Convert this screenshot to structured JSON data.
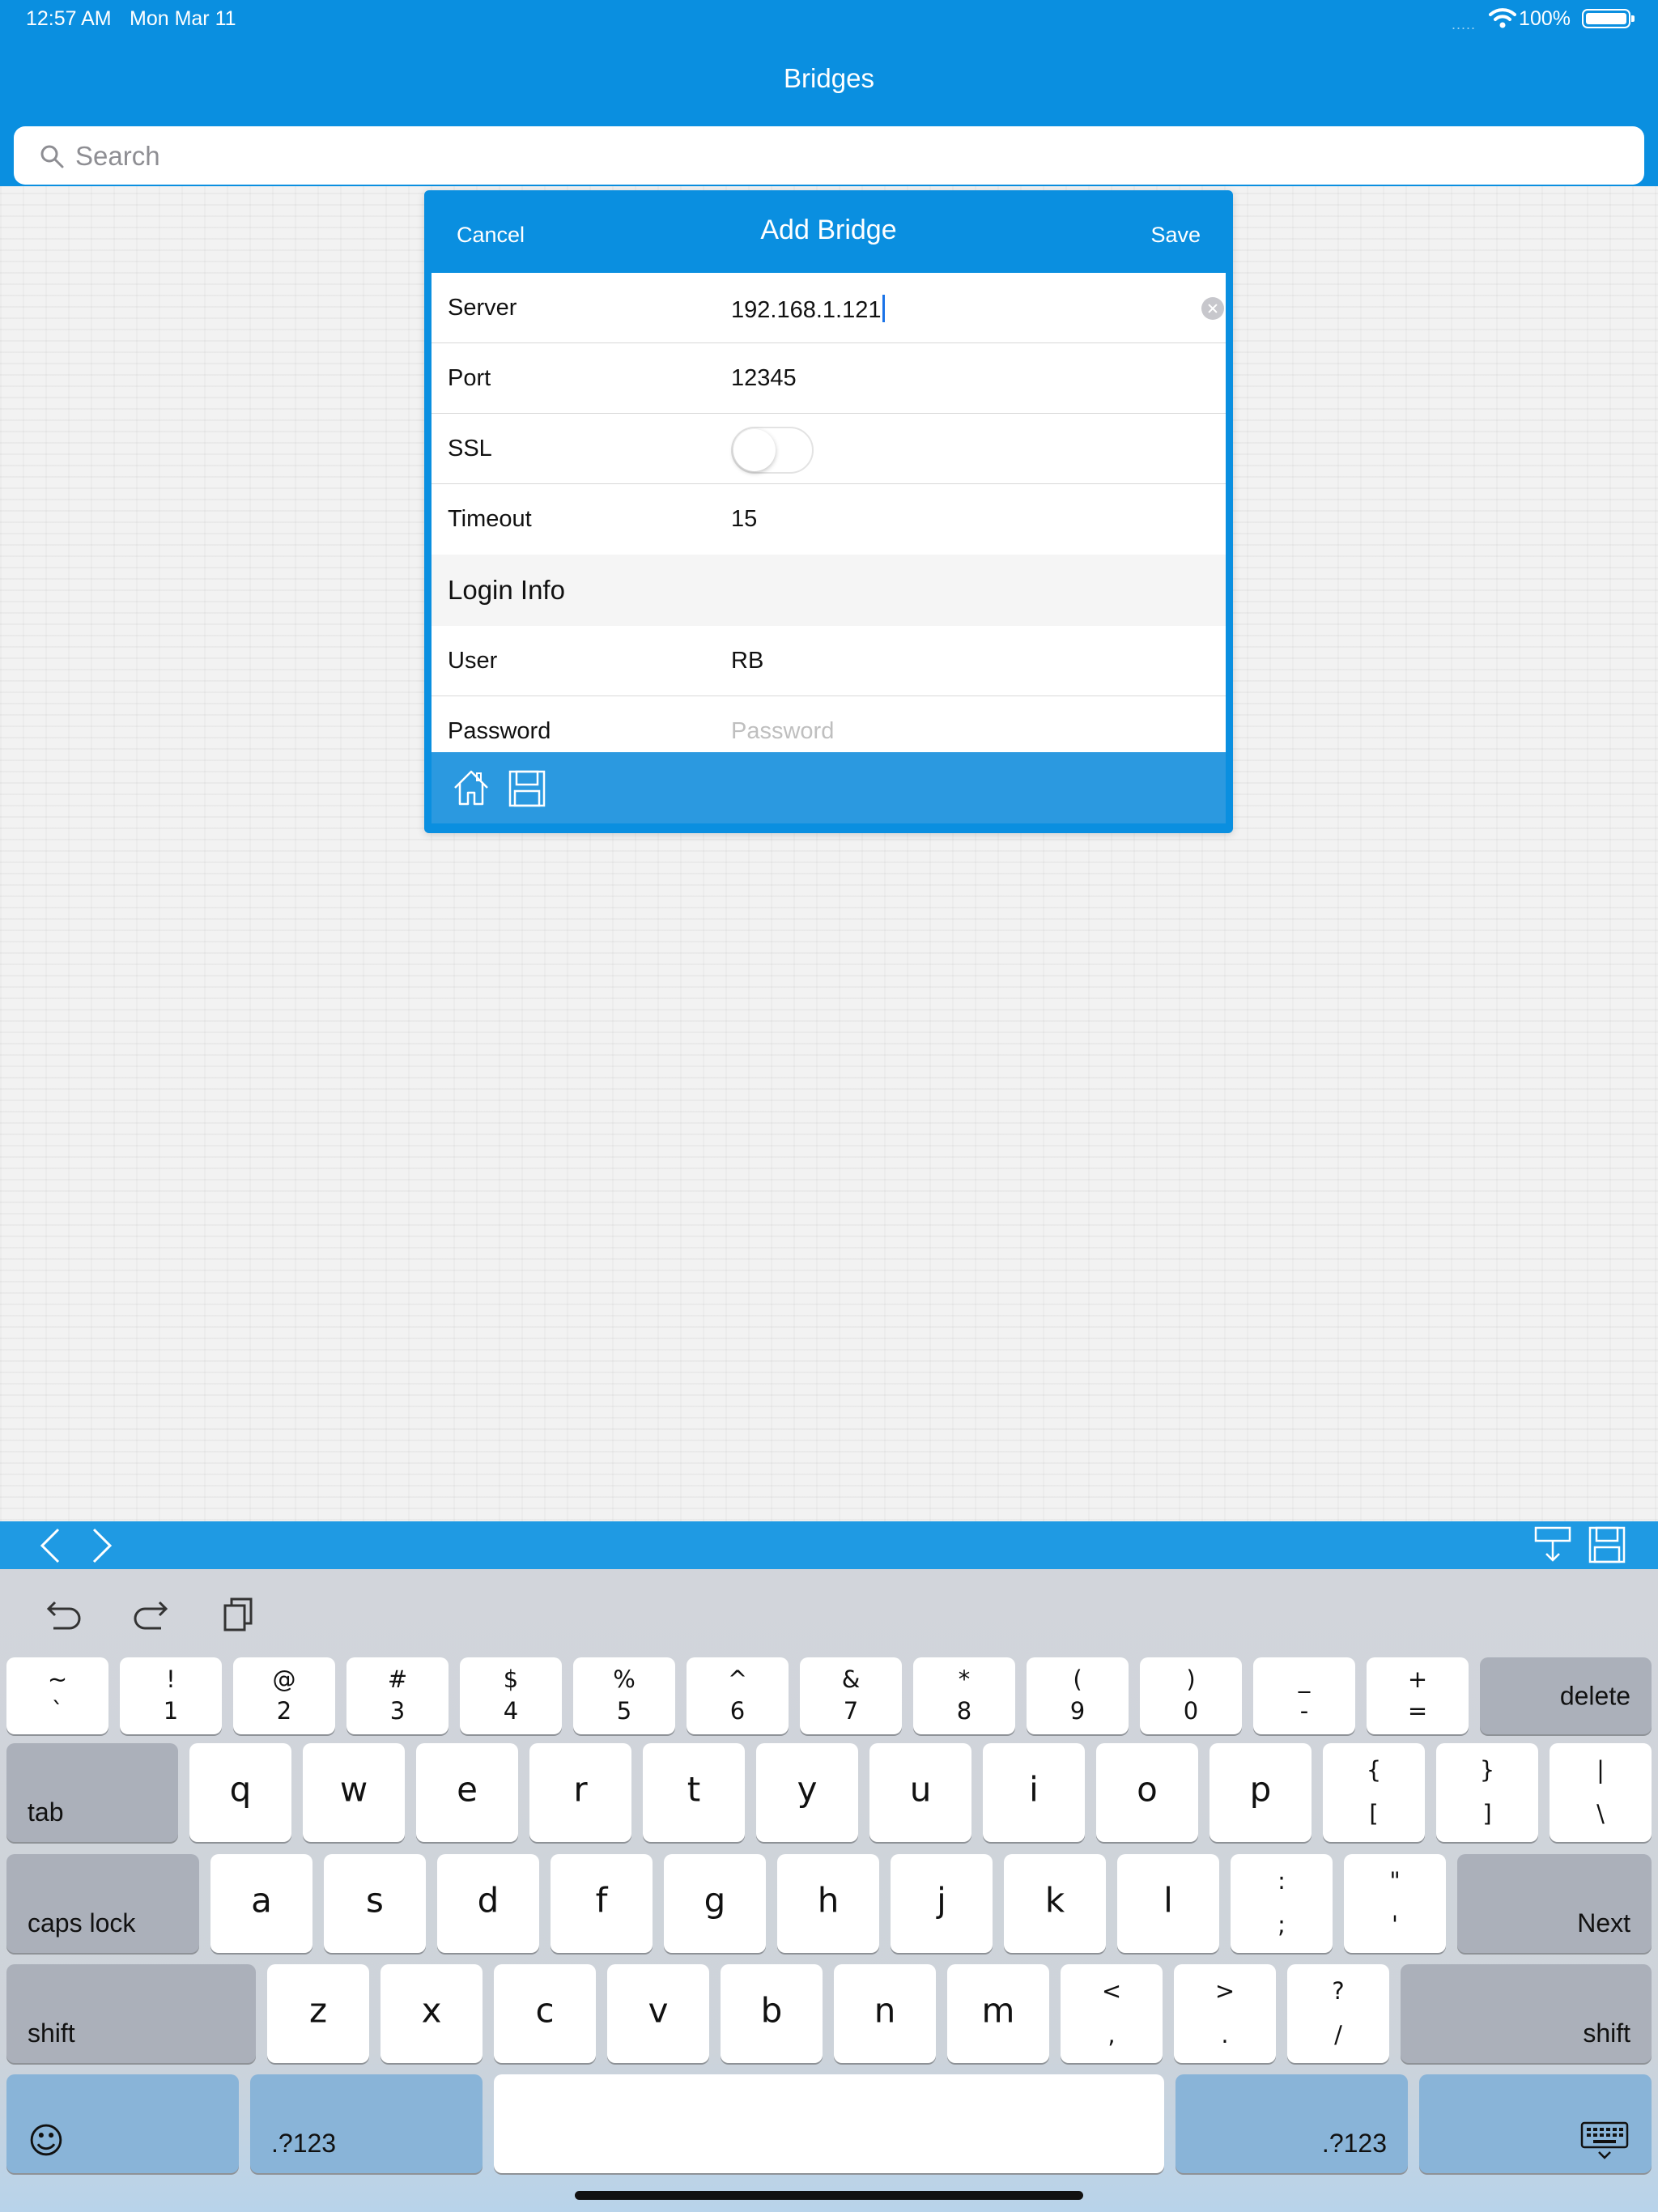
{
  "status_bar": {
    "time": "12:57 AM",
    "date": "Mon Mar 11",
    "battery": "100%",
    "signal_dots": "....."
  },
  "nav": {
    "title": "Bridges"
  },
  "search": {
    "placeholder": "Search",
    "value": ""
  },
  "modal": {
    "title": "Add Bridge",
    "cancel_label": "Cancel",
    "save_label": "Save",
    "fields": {
      "server": {
        "label": "Server",
        "value": "192.168.1.121"
      },
      "port": {
        "label": "Port",
        "value": "12345"
      },
      "ssl": {
        "label": "SSL",
        "enabled": false
      },
      "timeout": {
        "label": "Timeout",
        "value": "15"
      },
      "login_section": "Login Info",
      "user": {
        "label": "User",
        "value": "RB"
      },
      "password": {
        "label": "Password",
        "placeholder": "Password",
        "value": ""
      }
    },
    "toolbar_icons": [
      "home-icon",
      "floppy-disk-icon"
    ]
  },
  "accessory_bar": {
    "icons": [
      "chevron-left-icon",
      "chevron-right-icon",
      "dismiss-keyboard-icon",
      "floppy-disk-icon"
    ]
  },
  "keyboard": {
    "shortcut_icons": [
      "undo-icon",
      "redo-icon",
      "paste-icon"
    ],
    "number_row": [
      {
        "top": "~",
        "bottom": "`"
      },
      {
        "top": "!",
        "bottom": "1"
      },
      {
        "top": "@",
        "bottom": "2"
      },
      {
        "top": "#",
        "bottom": "3"
      },
      {
        "top": "$",
        "bottom": "4"
      },
      {
        "top": "%",
        "bottom": "5"
      },
      {
        "top": "^",
        "bottom": "6"
      },
      {
        "top": "&",
        "bottom": "7"
      },
      {
        "top": "*",
        "bottom": "8"
      },
      {
        "top": "(",
        "bottom": "9"
      },
      {
        "top": ")",
        "bottom": "0"
      },
      {
        "top": "_",
        "bottom": "-"
      },
      {
        "top": "+",
        "bottom": "="
      }
    ],
    "delete": "delete",
    "tab": "tab",
    "row_q": [
      "q",
      "w",
      "e",
      "r",
      "t",
      "y",
      "u",
      "i",
      "o",
      "p"
    ],
    "row_q_symbols": [
      {
        "top": "{",
        "bottom": "["
      },
      {
        "top": "}",
        "bottom": "]"
      },
      {
        "top": "|",
        "bottom": "\\"
      }
    ],
    "caps_lock": "caps lock",
    "row_a": [
      "a",
      "s",
      "d",
      "f",
      "g",
      "h",
      "j",
      "k",
      "l"
    ],
    "row_a_symbols": [
      {
        "top": ":",
        "bottom": ";"
      },
      {
        "top": "\"",
        "bottom": "'"
      }
    ],
    "next": "Next",
    "shift": "shift",
    "row_z": [
      "z",
      "x",
      "c",
      "v",
      "b",
      "n",
      "m"
    ],
    "row_z_symbols": [
      {
        "top": "<",
        "bottom": ","
      },
      {
        "top": ">",
        "bottom": "."
      },
      {
        "top": "?",
        "bottom": "/"
      }
    ],
    "emoji": "☺",
    "numbers_key": ".?123"
  }
}
